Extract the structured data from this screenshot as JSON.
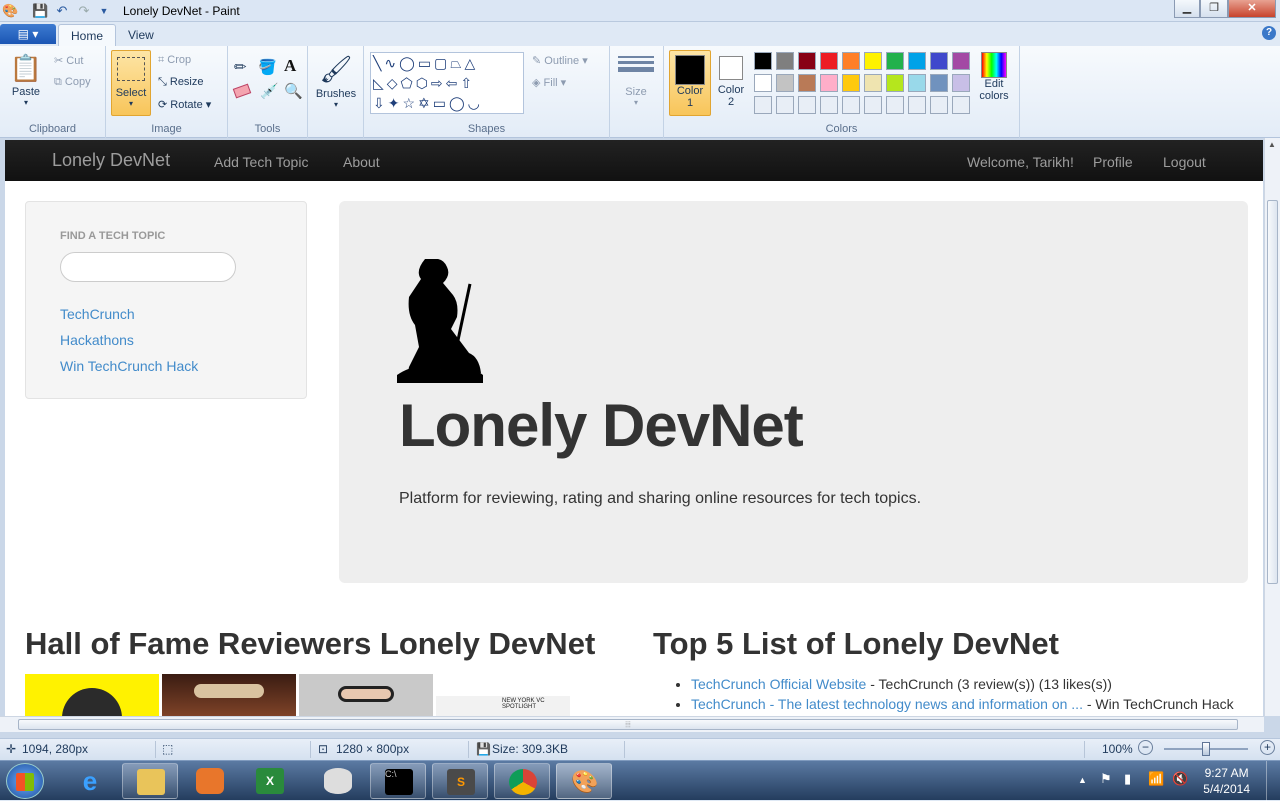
{
  "window": {
    "title": "Lonely DevNet - Paint"
  },
  "ribbon_tabs": [
    "Home",
    "View"
  ],
  "clipboard": {
    "paste": "Paste",
    "cut": "Cut",
    "copy": "Copy",
    "label": "Clipboard"
  },
  "image": {
    "select": "Select",
    "crop": "Crop",
    "resize": "Resize",
    "rotate": "Rotate",
    "label": "Image"
  },
  "tools": {
    "label": "Tools"
  },
  "brushes": {
    "label": "Brushes"
  },
  "shapes": {
    "outline": "Outline",
    "fill": "Fill",
    "label": "Shapes"
  },
  "size": {
    "label": "Size"
  },
  "colors": {
    "color1_a": "Color",
    "color1_b": "1",
    "color2_a": "Color",
    "color2_b": "2",
    "edit_a": "Edit",
    "edit_b": "colors",
    "label": "Colors",
    "color1": "#000000",
    "color2": "#ffffff",
    "palette_row1": [
      "#000000",
      "#7f7f7f",
      "#880015",
      "#ed1c24",
      "#ff7f27",
      "#fff200",
      "#22b14c",
      "#00a2e8",
      "#3f48cc",
      "#a349a4"
    ],
    "palette_row2": [
      "#ffffff",
      "#c3c3c3",
      "#b97a57",
      "#ffaec9",
      "#ffc90e",
      "#efe4b0",
      "#b5e61d",
      "#99d9ea",
      "#7092be",
      "#c8bfe7"
    ]
  },
  "site": {
    "brand": "Lonely DevNet",
    "nav": [
      "Add Tech Topic",
      "About"
    ],
    "nav_right": [
      "Welcome, Tarikh!",
      "Profile",
      "Logout"
    ],
    "sidebar": {
      "header": "FIND A TECH TOPIC",
      "links": [
        "TechCrunch",
        "Hackathons",
        "Win TechCrunch Hack"
      ]
    },
    "jumbotron": {
      "title": "Lonely DevNet",
      "desc": "Platform for reviewing, rating and sharing online resources for tech topics."
    },
    "hall_title": "Hall of Fame Reviewers Lonely DevNet",
    "top5_title": "Top 5 List of Lonely DevNet",
    "top5": [
      {
        "link": "TechCrunch Official Website",
        "rest": " - TechCrunch (3 review(s)) (13 likes(s))"
      },
      {
        "link": "TechCrunch - The latest technology news and information on ...",
        "rest": " - Win TechCrunch Hack"
      }
    ],
    "photo4_text": "NEW YORK VC SPOTLIGHT"
  },
  "status": {
    "cursor": "1094, 280px",
    "dimensions": "1280 × 800px",
    "size": "Size: 309.3KB",
    "zoom": "100%"
  },
  "clock": {
    "time": "9:27 AM",
    "date": "5/4/2014"
  }
}
